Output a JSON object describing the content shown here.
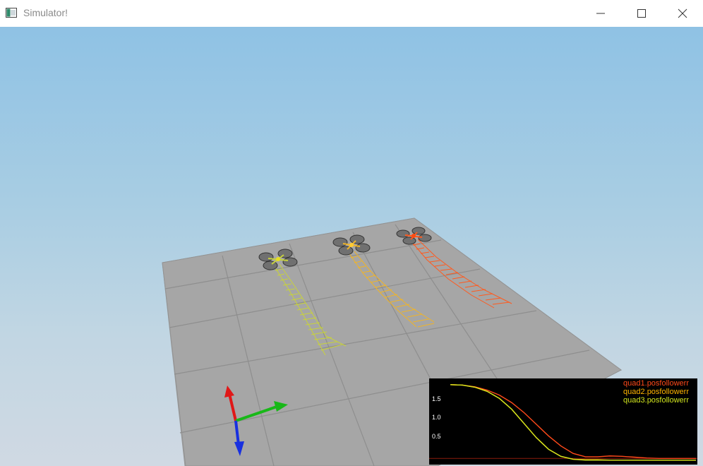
{
  "window": {
    "title": "Simulator!",
    "icon": "app-window-icon",
    "controls": {
      "minimize": "minimize-icon",
      "maximize": "maximize-icon",
      "close": "close-icon"
    }
  },
  "scene": {
    "quads": [
      {
        "name": "quad1",
        "color": "#ff5a1e"
      },
      {
        "name": "quad2",
        "color": "#f0b428"
      },
      {
        "name": "quad3",
        "color": "#c8d23c"
      }
    ]
  },
  "plot": {
    "legend": [
      {
        "label": "quad1.posfollowerr",
        "color": "#ff4a1a"
      },
      {
        "label": "quad2.posfollowerr",
        "color": "#ffb400"
      },
      {
        "label": "quad3.posfollowerr",
        "color": "#d2e61e"
      }
    ],
    "yticks": [
      "1.5",
      "1.0",
      "0.5"
    ]
  },
  "chart_data": {
    "type": "line",
    "ylim": [
      0,
      2.0
    ],
    "yticks": [
      1.5,
      1.0,
      0.5
    ],
    "x": [
      0,
      0.05,
      0.1,
      0.15,
      0.2,
      0.25,
      0.3,
      0.35,
      0.4,
      0.45,
      0.5,
      0.55,
      0.6,
      0.65,
      0.7,
      0.75,
      0.8,
      0.85,
      0.9,
      0.95,
      1.0
    ],
    "series": [
      {
        "name": "quad1.posfollowerr",
        "color": "#ff4a1a",
        "values": [
          1.85,
          1.84,
          1.8,
          1.72,
          1.6,
          1.42,
          1.18,
          0.9,
          0.62,
          0.38,
          0.2,
          0.12,
          0.12,
          0.14,
          0.13,
          0.11,
          0.09,
          0.08,
          0.08,
          0.08,
          0.08
        ]
      },
      {
        "name": "quad2.posfollowerr",
        "color": "#ffb400",
        "values": [
          1.85,
          1.84,
          1.79,
          1.69,
          1.52,
          1.26,
          0.92,
          0.58,
          0.3,
          0.13,
          0.06,
          0.05,
          0.05,
          0.04,
          0.04,
          0.04,
          0.04,
          0.04,
          0.04,
          0.04,
          0.04
        ]
      },
      {
        "name": "quad3.posfollowerr",
        "color": "#d2e61e",
        "values": [
          1.85,
          1.84,
          1.79,
          1.69,
          1.52,
          1.26,
          0.92,
          0.58,
          0.3,
          0.13,
          0.06,
          0.04,
          0.04,
          0.04,
          0.04,
          0.04,
          0.04,
          0.04,
          0.04,
          0.04,
          0.04
        ]
      }
    ]
  }
}
